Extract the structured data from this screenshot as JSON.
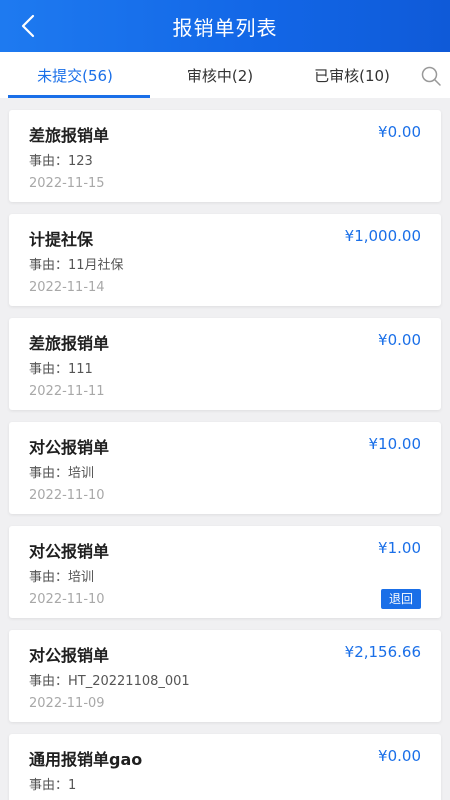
{
  "header": {
    "title": "报销单列表",
    "back_icon": "chevron-left-icon"
  },
  "tabs": [
    {
      "label": "未提交(56)",
      "active": true
    },
    {
      "label": "审核中(2)",
      "active": false
    },
    {
      "label": "已审核(10)",
      "active": false
    }
  ],
  "search": {
    "icon": "search-icon"
  },
  "colors": {
    "accent": "#1a6fe8",
    "background": "#f0f0f2",
    "header": "#1266e6"
  },
  "items": [
    {
      "title": "差旅报销单",
      "amount": "¥0.00",
      "reason": "事由：123",
      "date": "2022-11-15",
      "badge": ""
    },
    {
      "title": "计提社保",
      "amount": "¥1,000.00",
      "reason": "事由：11月社保",
      "date": "2022-11-14",
      "badge": ""
    },
    {
      "title": "差旅报销单",
      "amount": "¥0.00",
      "reason": "事由：111",
      "date": "2022-11-11",
      "badge": ""
    },
    {
      "title": "对公报销单",
      "amount": "¥10.00",
      "reason": "事由：培训",
      "date": "2022-11-10",
      "badge": ""
    },
    {
      "title": "对公报销单",
      "amount": "¥1.00",
      "reason": "事由：培训",
      "date": "2022-11-10",
      "badge": "退回"
    },
    {
      "title": "对公报销单",
      "amount": "¥2,156.66",
      "reason": "事由：HT_20221108_001",
      "date": "2022-11-09",
      "badge": ""
    },
    {
      "title": "通用报销单gao",
      "amount": "¥0.00",
      "reason": "事由：1",
      "date": "",
      "badge": ""
    }
  ]
}
